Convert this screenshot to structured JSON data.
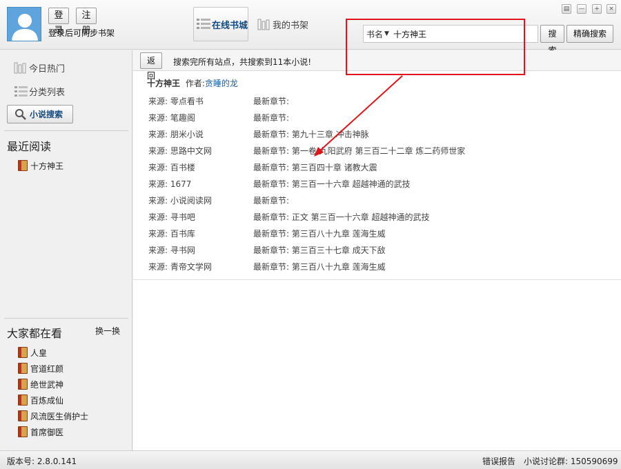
{
  "header": {
    "login_label": "登录",
    "register_label": "注册",
    "sync_hint": "登录后可同步书架",
    "nav_online_label": "在线书城",
    "nav_shelf_label": "我的书架",
    "search": {
      "type_label": "书名",
      "value": "十方神王",
      "search_label": "搜索",
      "exact_label": "精确搜索"
    },
    "window_controls": [
      "▤",
      "—",
      "+",
      "×"
    ]
  },
  "sidebar": {
    "hot_label": "今日热门",
    "category_label": "分类列表",
    "novel_search_label": "小说搜索",
    "recent_title": "最近阅读",
    "recent_books": [
      "十方神王"
    ],
    "popular_title": "大家都在看",
    "change_label": "换一换",
    "popular_books": [
      "人皇",
      "官道红颜",
      "绝世武神",
      "百炼成仙",
      "风流医生俏护士",
      "首席御医"
    ]
  },
  "main": {
    "back_label": "返回",
    "status_text": "搜索完所有站点，共搜索到11本小说!",
    "book_title": "十方神王",
    "author_prefix": "作者:",
    "author_name": "贪睡的龙",
    "results": [
      {
        "source": "来源: 零点看书",
        "latest": "最新章节:"
      },
      {
        "source": "来源: 笔趣阁",
        "latest": "最新章节:"
      },
      {
        "source": "来源: 朋米小说",
        "latest": "最新章节: 第九十三章 冲击神脉"
      },
      {
        "source": "来源: 思路中文网",
        "latest": "最新章节: 第一卷 九阳武府 第三百二十二章 炼二药师世家"
      },
      {
        "source": "来源: 百书楼",
        "latest": "最新章节: 第三百四十章 诸教大震"
      },
      {
        "source": "来源: 1677",
        "latest": "最新章节: 第三百一十六章 超越神通的武技"
      },
      {
        "source": "来源: 小说阅读网",
        "latest": "最新章节:"
      },
      {
        "source": "来源: 寻书吧",
        "latest": "最新章节: 正文 第三百一十六章 超越神通的武技"
      },
      {
        "source": "来源: 百书库",
        "latest": "最新章节: 第三百八十九章 莲海生威"
      },
      {
        "source": "来源: 寻书网",
        "latest": "最新章节: 第三百三十七章 成天下敌"
      },
      {
        "source": "来源: 青帝文学网",
        "latest": "最新章节: 第三百八十九章 莲海生威"
      }
    ]
  },
  "statusbar": {
    "version": "版本号: 2.8.0.141",
    "error_report": "错误报告",
    "qq_group": "小说讨论群: 150590699"
  },
  "annotation_color": "#e0141a"
}
